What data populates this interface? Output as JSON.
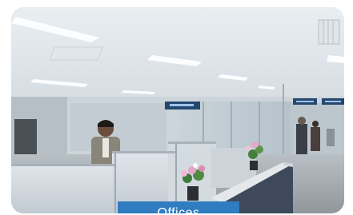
{
  "card": {
    "caption": "Offices"
  },
  "photo": {
    "subject": "open-plan-office-interior"
  },
  "colors": {
    "caption_background": "#2f7cc1",
    "caption_text": "#ffffff"
  }
}
